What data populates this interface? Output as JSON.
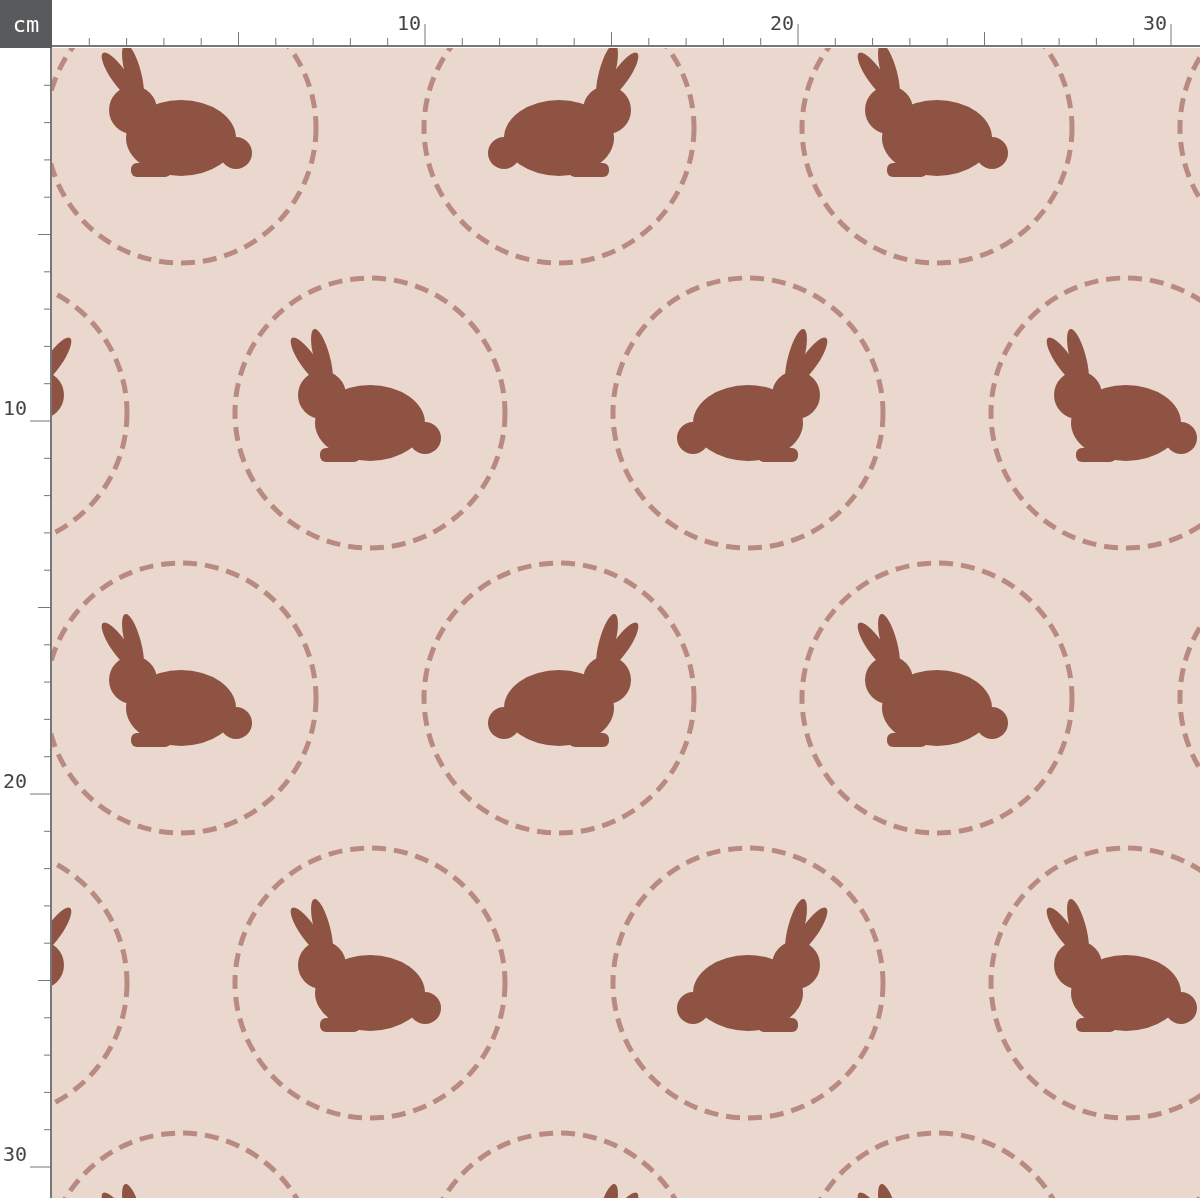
{
  "unit": "cm",
  "top_ruler": {
    "labels": [
      "10",
      "20",
      "30"
    ]
  },
  "left_ruler": {
    "labels": [
      "10",
      "20",
      "30"
    ]
  }
}
